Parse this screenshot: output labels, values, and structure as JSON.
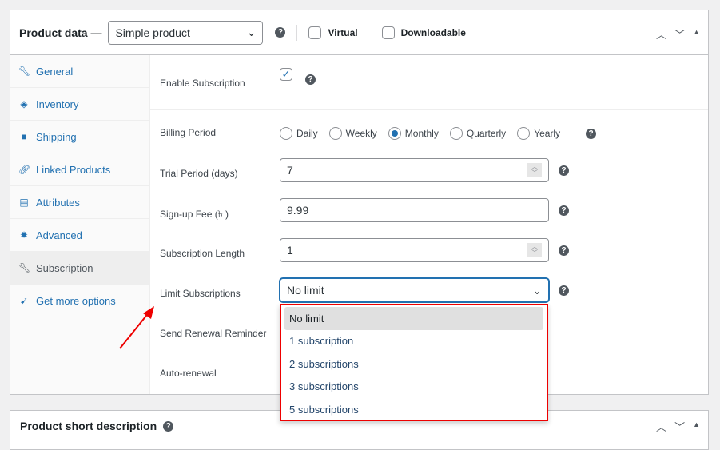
{
  "header": {
    "title": "Product data —",
    "product_type": "Simple product",
    "virtual_label": "Virtual",
    "downloadable_label": "Downloadable"
  },
  "sidebar": {
    "items": [
      {
        "label": "General",
        "icon": "wrench-icon"
      },
      {
        "label": "Inventory",
        "icon": "tag-icon"
      },
      {
        "label": "Shipping",
        "icon": "truck-icon"
      },
      {
        "label": "Linked Products",
        "icon": "link-icon"
      },
      {
        "label": "Attributes",
        "icon": "list-icon"
      },
      {
        "label": "Advanced",
        "icon": "gear-icon"
      },
      {
        "label": "Subscription",
        "icon": "wrench-icon",
        "active": true
      },
      {
        "label": "Get more options",
        "icon": "plugin-icon"
      }
    ]
  },
  "form": {
    "enable_label": "Enable Subscription",
    "enable_checked": true,
    "billing_label": "Billing Period",
    "billing_options": [
      "Daily",
      "Weekly",
      "Monthly",
      "Quarterly",
      "Yearly"
    ],
    "billing_selected": "Monthly",
    "trial_label": "Trial Period (days)",
    "trial_value": "7",
    "fee_label": "Sign-up Fee (৳ )",
    "fee_value": "9.99",
    "length_label": "Subscription Length",
    "length_value": "1",
    "limit_label": "Limit Subscriptions",
    "limit_value": "No limit",
    "limit_options": [
      "No limit",
      "1 subscription",
      "2 subscriptions",
      "3 subscriptions",
      "5 subscriptions"
    ],
    "reminder_label": "Send Renewal Reminder",
    "autorenew_label": "Auto-renewal"
  },
  "short_desc": {
    "title": "Product short description"
  },
  "colors": {
    "accent": "#2271b1",
    "highlight": "#e00000"
  }
}
